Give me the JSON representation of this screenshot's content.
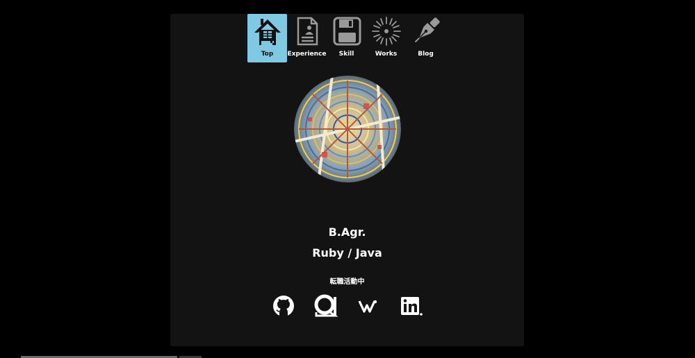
{
  "nav": {
    "items": [
      {
        "label": "Top",
        "icon": "house-icon",
        "active": true
      },
      {
        "label": "Experience",
        "icon": "resume-document-icon",
        "active": false
      },
      {
        "label": "Skill",
        "icon": "floppy-disk-icon",
        "active": false
      },
      {
        "label": "Works",
        "icon": "firework-icon",
        "active": false
      },
      {
        "label": "Blog",
        "icon": "fountain-pen-icon",
        "active": false
      }
    ],
    "active_color": "#7fc9e2"
  },
  "profile": {
    "avatar_icon": "stained-glass-avatar",
    "name": "B.Agr.",
    "languages": "Ruby / Java",
    "status": "転職活動中"
  },
  "social": [
    {
      "icon": "github-icon"
    },
    {
      "icon": "qiita-icon"
    },
    {
      "icon": "wantedly-icon"
    },
    {
      "icon": "linkedin-icon"
    }
  ],
  "colors": {
    "background": "#000000",
    "card": "#131313",
    "text": "#ffffff"
  }
}
